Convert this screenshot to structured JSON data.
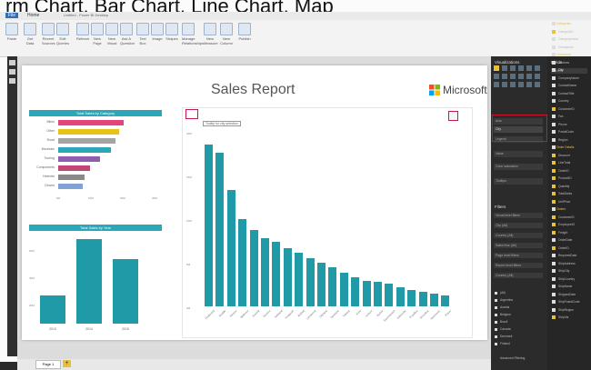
{
  "caption": "rm Chart, Bar Chart, Line Chart, Map",
  "window_title": "Untitled - Power BI Desktop",
  "ribbon": {
    "tabs": [
      "File",
      "Home"
    ],
    "buttons": [
      "Paste",
      "Get Data",
      "Recent Sources",
      "Edit Queries",
      "Refresh",
      "New Page",
      "New Visual",
      "Ask A Question",
      "Text Box",
      "Image",
      "Shapes",
      "Manage Relationships",
      "New Measure",
      "New Column",
      "Publish"
    ]
  },
  "report": {
    "title": "Sales Report",
    "brand": "Microsoft",
    "category_chart": {
      "title": "Total Sales by Category",
      "categories": [
        "Bikes",
        "Other",
        "Road",
        "Mountain",
        "Touring",
        "Components",
        "Helmets",
        "Gloves"
      ],
      "colors": [
        "#e0457b",
        "#e8c21a",
        "#a4a4a4",
        "#2aa7b8",
        "#8e5fb0",
        "#c04873",
        "#8a8a8a",
        "#7fa3d6"
      ],
      "values": [
        100,
        93,
        88,
        80,
        64,
        48,
        40,
        38
      ],
      "xticks": [
        "0M",
        "10M",
        "20M",
        "30M"
      ]
    },
    "year_chart": {
      "title": "Total Sales by Year",
      "years": [
        "2013",
        "2014",
        "2015"
      ],
      "values": [
        22,
        65,
        50
      ],
      "yticks": [
        "60M",
        "40M",
        "20M"
      ]
    },
    "main_chart": {
      "tooltip": "Tooltip for city selection",
      "values": [
        100,
        95,
        72,
        54,
        47,
        42,
        40,
        36,
        33,
        30,
        27,
        24,
        21,
        18,
        16,
        15,
        14,
        12,
        10,
        9,
        8,
        7
      ],
      "labels": [
        "Redmond",
        "Seattle",
        "Renton",
        "Bellevue",
        "Everett",
        "Tacoma",
        "Kirkland",
        "Issaquah",
        "Bothell",
        "Lynnwood",
        "Olympia",
        "Spokane",
        "Yakima",
        "Kent",
        "Auburn",
        "Burien",
        "Sammamish",
        "Edmonds",
        "Puyallup",
        "Shoreline",
        "Vancouver",
        "Pasco"
      ],
      "yticks": [
        "20M",
        "15M",
        "10M",
        "5M",
        "0M"
      ]
    }
  },
  "pages": {
    "current": "Page 1",
    "add": "+"
  },
  "visualizations": {
    "title": "Visualizations",
    "rows": [
      "Axis",
      "Legend",
      "Value",
      "Color saturation",
      "Tooltips"
    ],
    "axis_field": "City",
    "filters_title": "Filters",
    "filters": [
      "Visual level filters",
      "City (All)",
      "Country (All)",
      "SalesYear (All)",
      "Page level filters",
      "Report level filters",
      "Country (All)"
    ],
    "filter_values": [
      "(All)",
      "Argentina",
      "Austria",
      "Belgium",
      "Brazil",
      "Canada",
      "Denmark",
      "Finland"
    ],
    "advanced": "Advanced Filtering"
  },
  "fields": {
    "title": "Fields",
    "search": "Search",
    "items": [
      "Categories",
      "CategoryID",
      "CategoryName",
      "Description",
      "Customers",
      "Address",
      "City",
      "CompanyName",
      "ContactName",
      "ContactTitle",
      "Country",
      "CustomerID",
      "Fax",
      "Phone",
      "PostalCode",
      "Region",
      "Order Details",
      "Discount",
      "LineTotal",
      "OrderID",
      "ProductID",
      "Quantity",
      "TotalSales",
      "UnitPrice",
      "Orders",
      "CustomerID",
      "EmployeeID",
      "Freight",
      "OrderDate",
      "OrderID",
      "RequiredDate",
      "ShipAddress",
      "ShipCity",
      "ShipCountry",
      "ShipName",
      "ShippedDate",
      "ShipPostalCode",
      "ShipRegion",
      "ShipVia"
    ]
  }
}
